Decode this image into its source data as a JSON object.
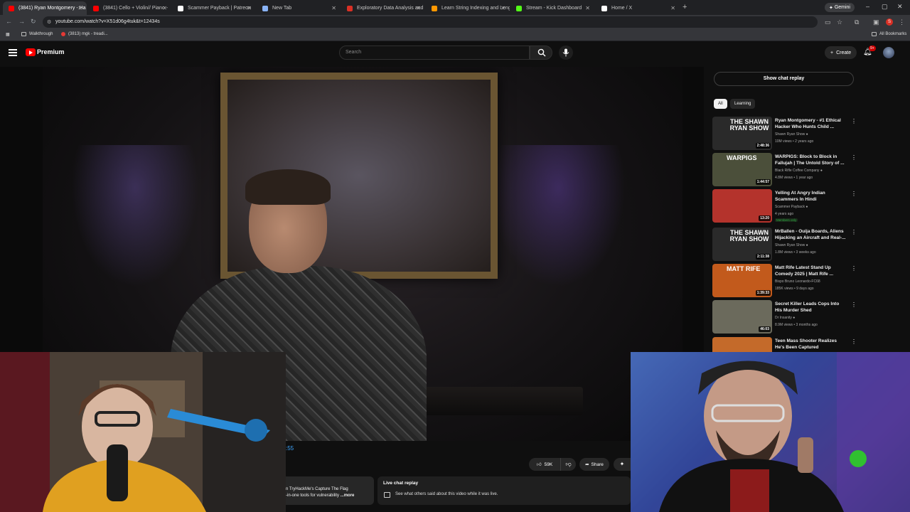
{
  "browser": {
    "tabs": [
      {
        "label": "(3841) Ryan Montgomery - Ha",
        "active": true,
        "color": "#ff0000"
      },
      {
        "label": "(3841) Cello + Violin// Piano -",
        "active": false,
        "color": "#ff0000"
      },
      {
        "label": "Scammer Payback | Patreon",
        "active": false,
        "color": "#ffffff"
      },
      {
        "label": "New Tab",
        "active": false,
        "color": "#8ab4f8"
      },
      {
        "label": "Exploratory Data Analysis and",
        "active": false,
        "color": "#d93025"
      },
      {
        "label": "Learn String Indexing and Leng",
        "active": false,
        "color": "#ff9800"
      },
      {
        "label": "Stream - Kick Dashboard",
        "active": false,
        "color": "#53fc18"
      },
      {
        "label": "Home / X",
        "active": false,
        "color": "#ffffff"
      }
    ],
    "gemini_label": "Gemini",
    "url": "youtube.com/watch?v=X51d06g4tuk&t=12434s",
    "profile_initial": "S",
    "bookmarks": [
      {
        "label": "Walkthrough"
      },
      {
        "label": "(3813) mgk - treadi..."
      }
    ],
    "all_bookmarks": "All Bookmarks"
  },
  "youtube": {
    "brand": "Premium",
    "search_placeholder": "Search",
    "create_label": "Create",
    "notif_count": "9+"
  },
  "sidebar": {
    "show_chat_replay": "Show chat replay",
    "chips": [
      "All",
      "Learning"
    ],
    "recommendations": [
      {
        "title": "Ryan Montgomery - #1 Ethical Hacker Who Hunts Child ...",
        "channel": "Shawn Ryan Show",
        "meta": "10M views • 2 years ago",
        "duration": "2:48:36",
        "thumb_text": "THE SHAWN RYAN SHOW",
        "thumb_color": "#2a2a2a",
        "verified": true,
        "members": ""
      },
      {
        "title": "WARPIGS: Block to Block in Fallujah | The Untold Story of ...",
        "channel": "Black Rifle Coffee Company",
        "meta": "4.8M views • 1 year ago",
        "duration": "1:44:57",
        "thumb_text": "WARPIGS",
        "thumb_color": "#4b4f3a",
        "verified": true,
        "members": ""
      },
      {
        "title": "Yelling At Angry Indian Scammers In Hindi",
        "channel": "Scammer Payback",
        "meta": "4 years ago",
        "duration": "13:20",
        "thumb_text": "",
        "thumb_color": "#b4332c",
        "verified": true,
        "members": "Members only"
      },
      {
        "title": "MrBallen - Ouija Boards, Aliens Hijacking an Aircraft and Real-...",
        "channel": "Shawn Ryan Show",
        "meta": "1.8M views • 3 weeks ago",
        "duration": "2:11:38",
        "thumb_text": "THE SHAWN RYAN SHOW",
        "thumb_color": "#2a2a2a",
        "verified": true,
        "members": ""
      },
      {
        "title": "Matt Rife Latest Stand Up Comedy 2025 | Matt Rife ...",
        "channel": "Bispo Bruno Leonardo-FC68",
        "meta": "185K views • 9 days ago",
        "duration": "1:39:33",
        "thumb_text": "MATT RIFE",
        "thumb_color": "#c25a1c",
        "verified": false,
        "members": ""
      },
      {
        "title": "Secret Killer Leads Cops Into His Murder Shed",
        "channel": "Dr Insanity",
        "meta": "8.9M views • 3 months ago",
        "duration": "46:03",
        "thumb_text": "",
        "thumb_color": "#6b6a5c",
        "verified": true,
        "members": ""
      },
      {
        "title": "Teen Mass Shooter Realizes He's Been Captured",
        "channel": "",
        "meta": "",
        "duration": "",
        "thumb_text": "",
        "thumb_color": "#c46a2a",
        "verified": false,
        "members": ""
      }
    ]
  },
  "below_video": {
    "time_fragment": ":55",
    "likes": "59K",
    "share_label": "Share",
    "description_line1": "n TryHackMe's Capture The Flag",
    "description_line2": "-in-one tools for vulnerability",
    "description_more": "...more",
    "live_chat_title": "Live chat replay",
    "live_chat_sub": "See what others said about this video while it was live."
  },
  "colors": {
    "accent": "#ff0000",
    "link": "#3ea6ff",
    "bg": "#0f0f0f"
  }
}
